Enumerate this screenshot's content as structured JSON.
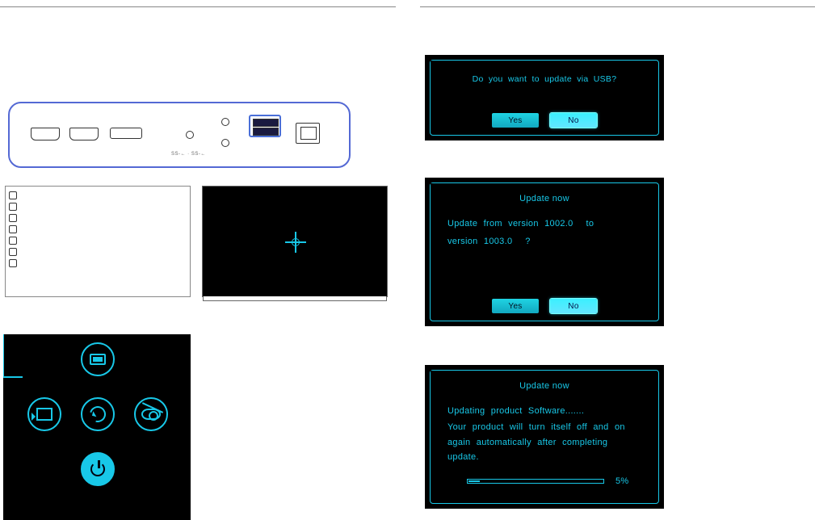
{
  "ports": {
    "labels": "SS-← · SS-←"
  },
  "navigation": {
    "top_icon": "monitor-icon",
    "left_icon": "input-source-icon",
    "center_icon": "back-icon",
    "right_icon": "eye-off-icon",
    "power_icon": "power-icon"
  },
  "dialog1": {
    "prompt": "Do you want to update via USB?",
    "yes": "Yes",
    "no": "No"
  },
  "dialog2": {
    "title": "Update now",
    "line_prefix": "Update from version",
    "version_from": "1002.0",
    "line_mid": "to",
    "line2_prefix": "version",
    "version_to": "1003.0",
    "line_suffix": "?",
    "yes": "Yes",
    "no": "No"
  },
  "dialog3": {
    "title": "Update now",
    "line1": "Updating product Software.......",
    "line2": "Your product will turn itself off and on again automatically after completing update.",
    "progress_percent": "5%"
  }
}
